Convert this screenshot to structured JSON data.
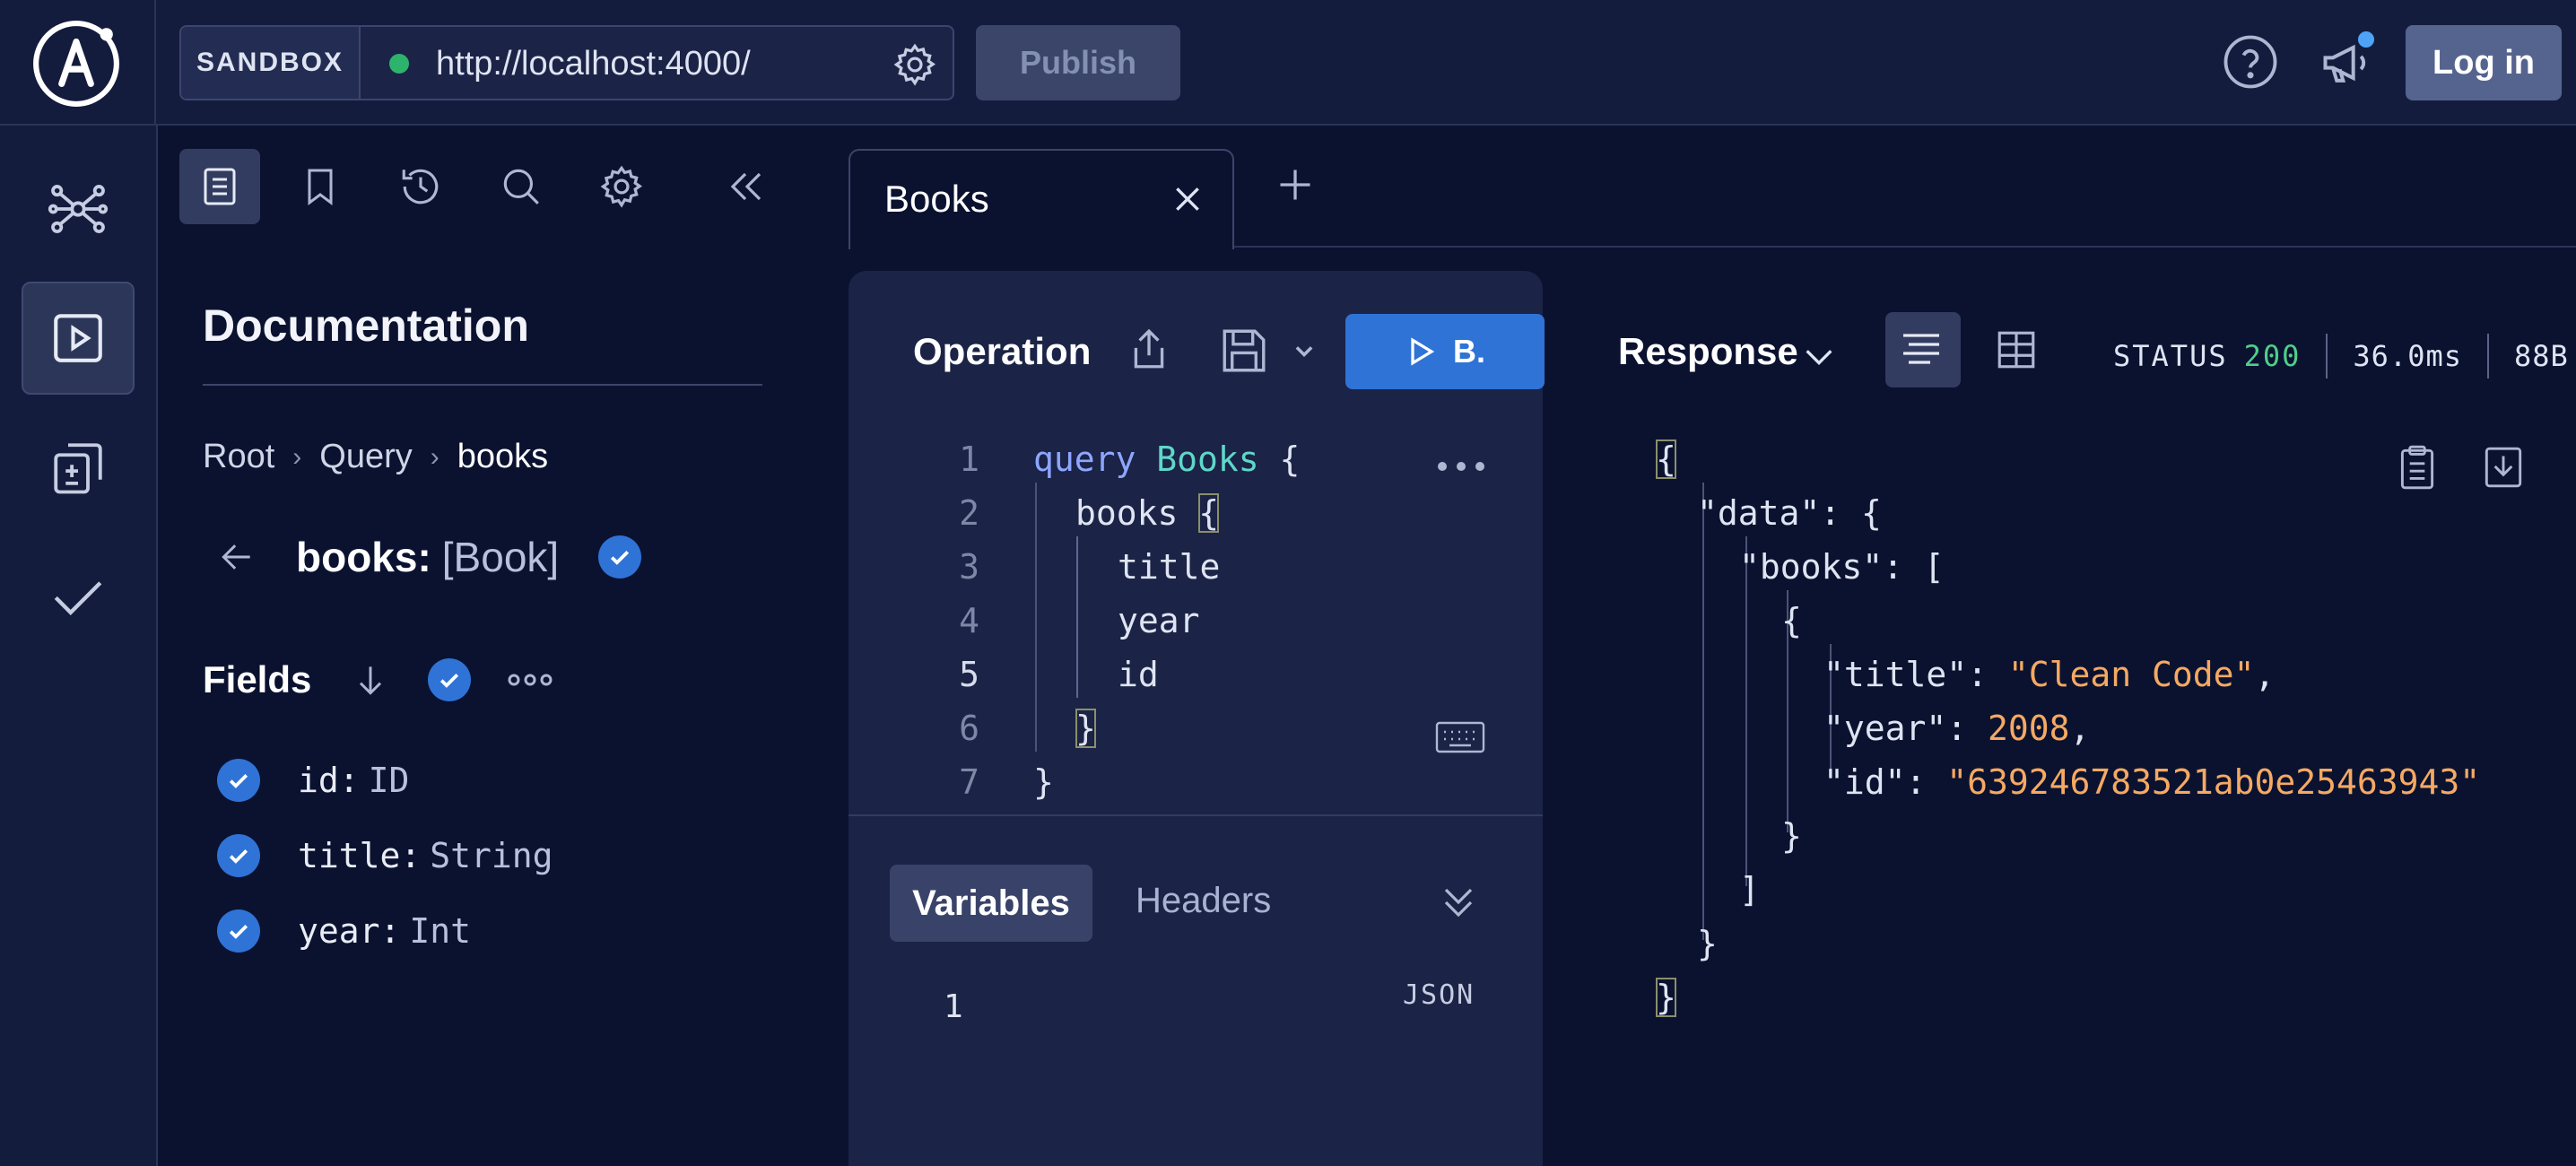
{
  "topbar": {
    "sandbox_label": "SANDBOX",
    "url": "http://localhost:4000/",
    "publish_label": "Publish",
    "login_label": "Log in"
  },
  "docs_toolbar": {
    "icons": [
      "document-icon",
      "bookmark-icon",
      "history-icon",
      "search-icon",
      "settings-icon",
      "collapse-left-icon"
    ]
  },
  "docs": {
    "title": "Documentation",
    "breadcrumb": [
      "Root",
      "Query",
      "books"
    ],
    "field_name": "books:",
    "field_type": "[Book]",
    "fields_label": "Fields",
    "fields": [
      {
        "name": "id:",
        "type": "ID"
      },
      {
        "name": "title:",
        "type": "String"
      },
      {
        "name": "year:",
        "type": "Int"
      }
    ]
  },
  "tabs": [
    {
      "label": "Books"
    }
  ],
  "operation": {
    "title": "Operation",
    "run_label": "B.",
    "lines": [
      "1",
      "2",
      "3",
      "4",
      "5",
      "6",
      "7"
    ],
    "code": {
      "l1_kw": "query",
      "l1_name": "Books",
      "l1_rest": " {",
      "l2": "books",
      "l2_brace": "{",
      "l3": "title",
      "l4": "year",
      "l5": "id",
      "l6": "}",
      "l7": "}"
    },
    "variables_tab": "Variables",
    "headers_tab": "Headers",
    "variables_line": "1",
    "variables_format": "JSON"
  },
  "response": {
    "title": "Response",
    "status_label": "STATUS",
    "status_code": "200",
    "time": "36.0ms",
    "size": "88B",
    "json": {
      "open": "{",
      "data_key": "\"data\": {",
      "books_key": "\"books\": [",
      "obj_open": "{",
      "title_key": "\"title\": ",
      "title_val": "\"Clean Code\"",
      "year_key": "\"year\": ",
      "year_val": "2008",
      "id_key": "\"id\": ",
      "id_val": "\"639246783521ab0e25463943\"",
      "obj_close": "}",
      "arr_close": "]",
      "data_close": "}",
      "close": "}",
      "comma": ","
    }
  },
  "colors": {
    "background": "#0b1230",
    "panel": "#1b2346",
    "accent": "#2f73d6",
    "status_ok": "#4fcf8a",
    "string_value": "#f5a962"
  }
}
